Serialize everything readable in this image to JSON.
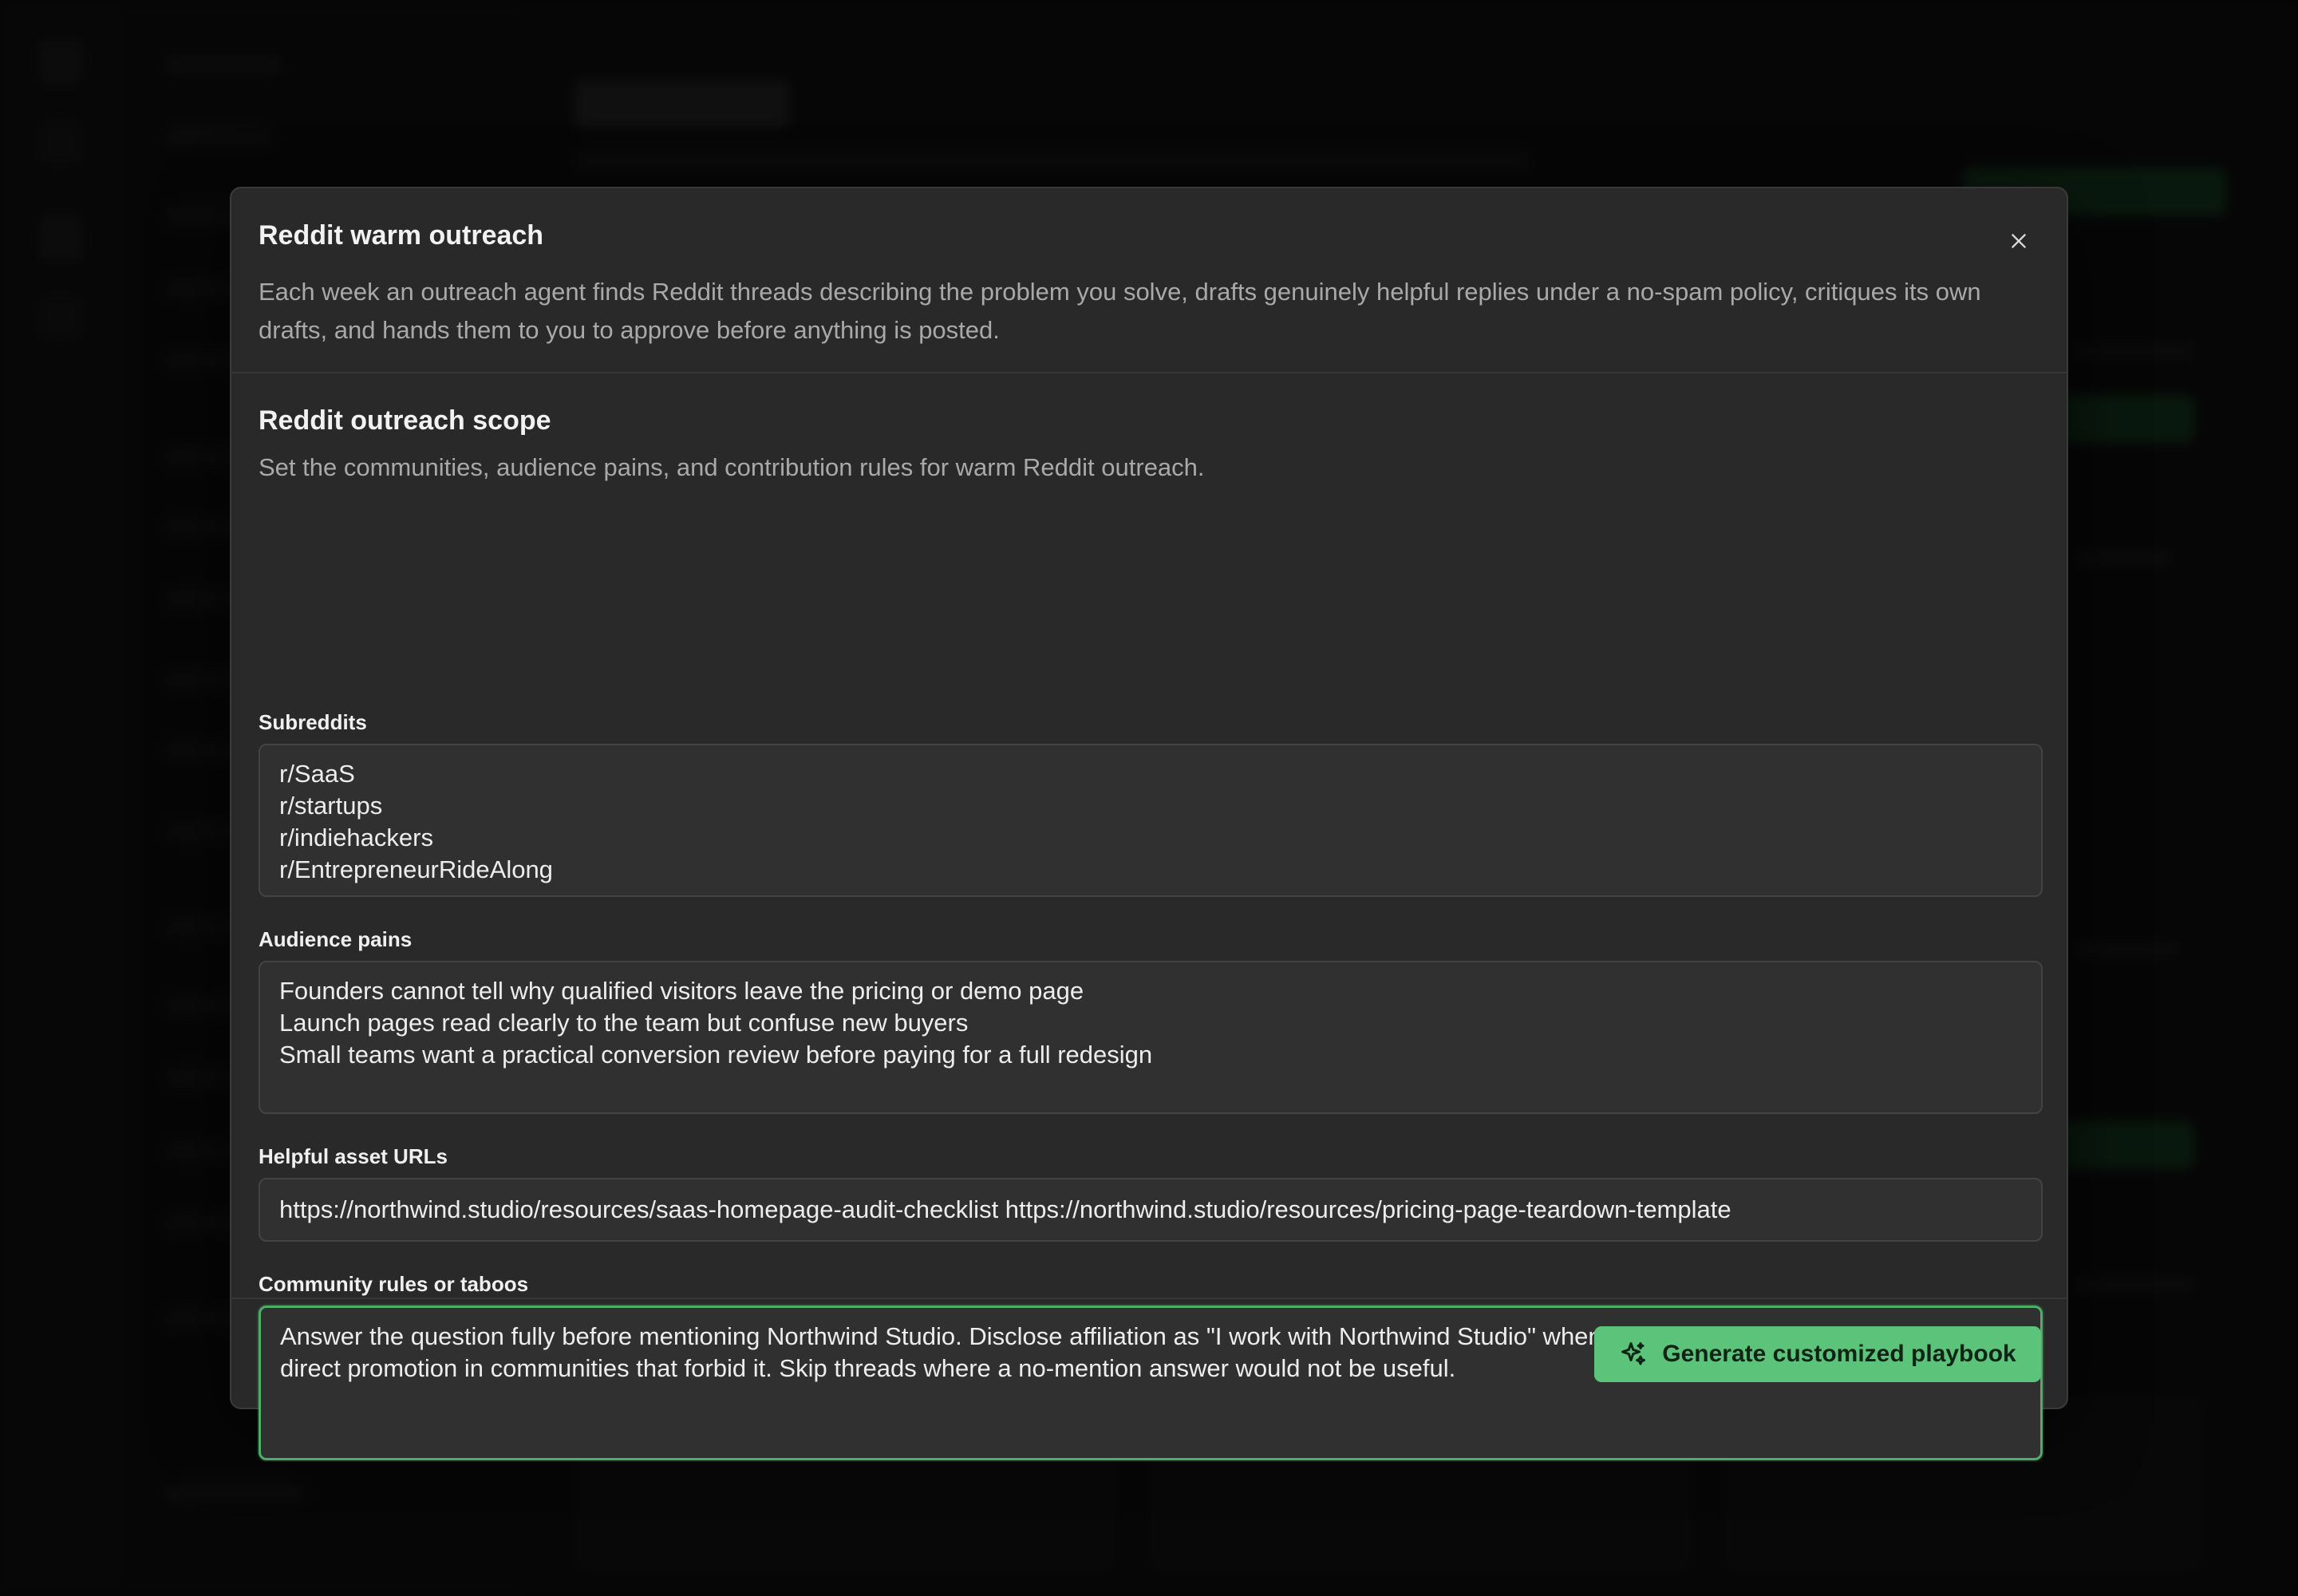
{
  "modal": {
    "title": "Reddit warm outreach",
    "description": "Each week an outreach agent finds Reddit threads describing the problem you solve, drafts genuinely helpful replies under a no-spam policy, critiques its own drafts, and hands them to you to approve before anything is posted.",
    "close_icon": "close-icon"
  },
  "section": {
    "title": "Reddit outreach scope",
    "description": "Set the communities, audience pains, and contribution rules for warm Reddit outreach."
  },
  "fields": {
    "subreddits": {
      "label": "Subreddits",
      "value": "r/SaaS\nr/startups\nr/indiehackers\nr/EntrepreneurRideAlong"
    },
    "audience_pains": {
      "label": "Audience pains",
      "value": "Founders cannot tell why qualified visitors leave the pricing or demo page\nLaunch pages read clearly to the team but confuse new buyers\nSmall teams want a practical conversion review before paying for a full redesign"
    },
    "asset_urls": {
      "label": "Helpful asset URLs",
      "value": "https://northwind.studio/resources/saas-homepage-audit-checklist https://northwind.studio/resources/pricing-page-teardown-template"
    },
    "community_rules": {
      "label": "Community rules or taboos",
      "value": "Answer the question fully before mentioning Northwind Studio. Disclose affiliation as \"I work with Northwind Studio\" whenever the studio is named. Do not post direct promotion in communities that forbid it. Skip threads where a no-mention answer would not be useful."
    }
  },
  "footer": {
    "generate_label": "Generate customized playbook",
    "generate_icon": "sparkles-icon"
  },
  "colors": {
    "accent": "#5cc47a",
    "focus_border": "#4cae67",
    "modal_bg": "#292929",
    "field_bg": "#303030"
  }
}
